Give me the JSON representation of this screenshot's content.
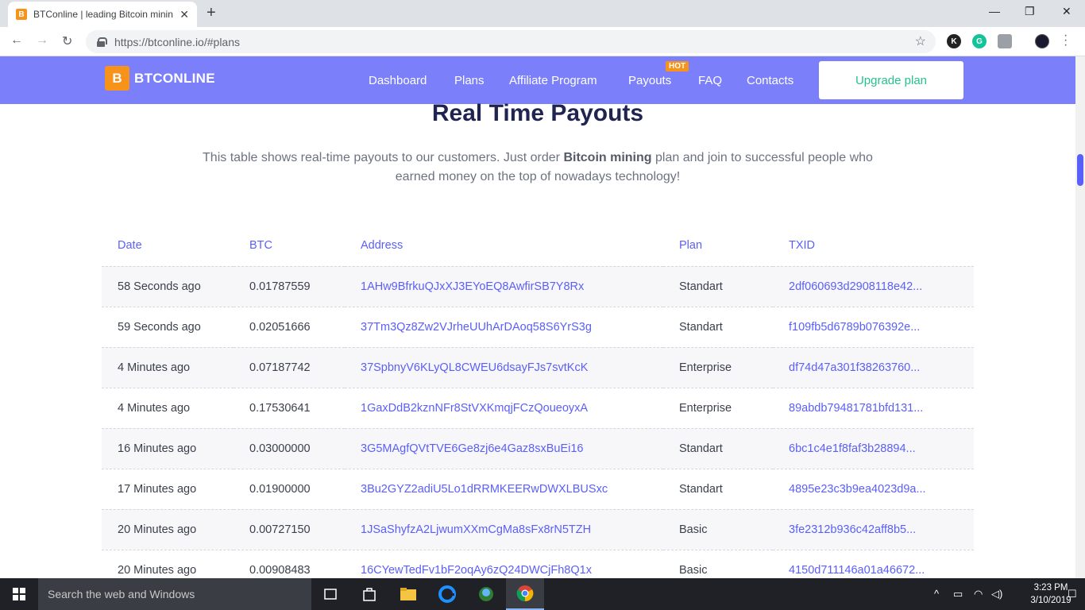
{
  "browser": {
    "tab_title": "BTConline | leading Bitcoin minin",
    "tab_favicon": "B",
    "new_tab": "+",
    "url_host": "https://btconline.io/",
    "url_path": "#plans",
    "controls": {
      "minimize": "—",
      "restore": "❐",
      "close": "✕"
    },
    "nav": {
      "back": "←",
      "forward": "→",
      "reload": "↻"
    },
    "star": "☆",
    "extensions": [
      {
        "label": "K",
        "color": "#222222"
      },
      {
        "label": "G",
        "color": "#15c39a"
      },
      {
        "label": "",
        "color": "#9aa0a6"
      },
      {
        "label": "",
        "color": "#1a1a2e"
      }
    ]
  },
  "site": {
    "logo_mark": "B",
    "logo_text": "BTCONLINE",
    "nav": {
      "dashboard": "Dashboard",
      "plans": "Plans",
      "affiliate": "Affiliate Program",
      "payouts": "Payouts",
      "faq": "FAQ",
      "contacts": "Contacts"
    },
    "hot_badge": "HOT",
    "upgrade_button": "Upgrade plan"
  },
  "section": {
    "title": "Real Time Payouts",
    "desc_prefix": "This table shows real-time payouts to our customers. Just order ",
    "desc_bold": "Bitcoin mining",
    "desc_suffix": " plan and join to successful people who earned money on the top of nowadays technology!"
  },
  "table": {
    "headers": {
      "date": "Date",
      "btc": "BTC",
      "address": "Address",
      "plan": "Plan",
      "txid": "TXID"
    },
    "rows": [
      {
        "date": "58 Seconds ago",
        "btc": "0.01787559",
        "address": "1AHw9BfrkuQJxXJ3EYoEQ8AwfirSB7Y8Rx",
        "plan": "Standart",
        "txid": "2df060693d2908118e42..."
      },
      {
        "date": "59 Seconds ago",
        "btc": "0.02051666",
        "address": "37Tm3Qz8Zw2VJrheUUhArDAoq58S6YrS3g",
        "plan": "Standart",
        "txid": "f109fb5d6789b076392e..."
      },
      {
        "date": "4 Minutes ago",
        "btc": "0.07187742",
        "address": "37SpbnyV6KLyQL8CWEU6dsayFJs7svtKcK",
        "plan": "Enterprise",
        "txid": "df74d47a301f38263760..."
      },
      {
        "date": "4 Minutes ago",
        "btc": "0.17530641",
        "address": "1GaxDdB2kznNFr8StVXKmqjFCzQoueoyxA",
        "plan": "Enterprise",
        "txid": "89abdb79481781bfd131..."
      },
      {
        "date": "16 Minutes ago",
        "btc": "0.03000000",
        "address": "3G5MAgfQVtTVE6Ge8zj6e4Gaz8sxBuEi16",
        "plan": "Standart",
        "txid": "6bc1c4e1f8faf3b28894..."
      },
      {
        "date": "17 Minutes ago",
        "btc": "0.01900000",
        "address": "3Bu2GYZ2adiU5Lo1dRRMKEERwDWXLBUSxc",
        "plan": "Standart",
        "txid": "4895e23c3b9ea4023d9a..."
      },
      {
        "date": "20 Minutes ago",
        "btc": "0.00727150",
        "address": "1JSaShyfzA2LjwumXXmCgMa8sFx8rN5TZH",
        "plan": "Basic",
        "txid": "3fe2312b936c42aff8b5..."
      },
      {
        "date": "20 Minutes ago",
        "btc": "0.00908483",
        "address": "16CYewTedFv1bF2oqAy6zQ24DWCjFh8Q1x",
        "plan": "Basic",
        "txid": "4150d711146a01a46672..."
      }
    ]
  },
  "taskbar": {
    "search_placeholder": "Search the web and Windows",
    "time": "3:23 PM",
    "date": "3/10/2019",
    "tray_icons": [
      "chevron-up-icon",
      "battery-icon",
      "wifi-icon",
      "volume-icon",
      "notification-icon"
    ]
  },
  "colors": {
    "brand": "#7b7ff9",
    "accent": "#5a5ffa",
    "bitcoin": "#f7931a",
    "upgrade_text": "#27c28c"
  }
}
